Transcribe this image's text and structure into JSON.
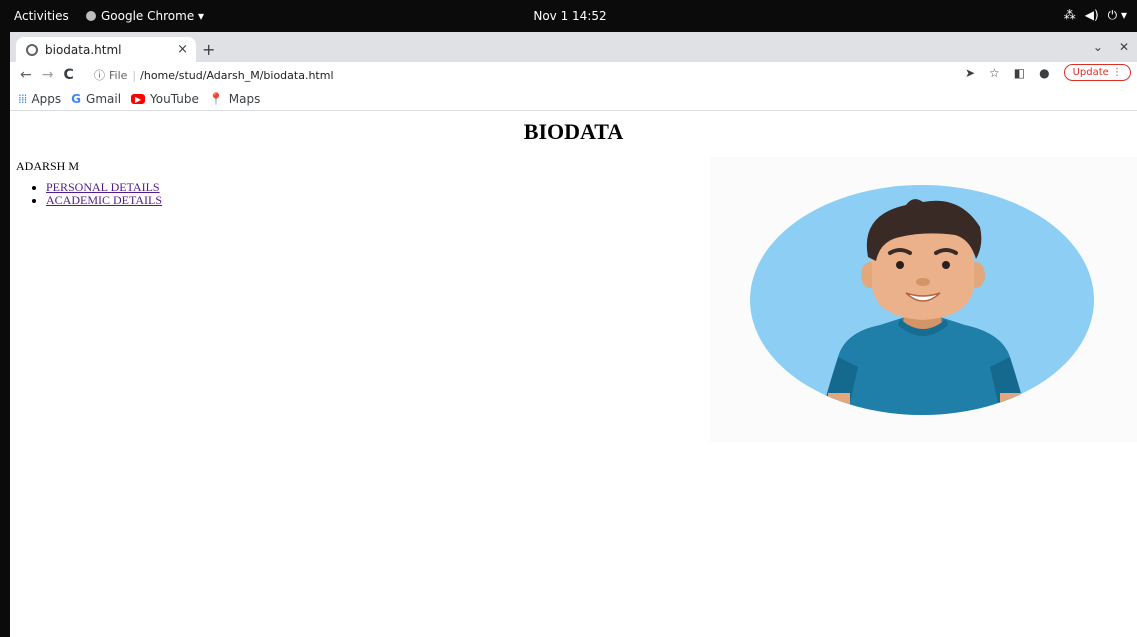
{
  "system_bar": {
    "activities": "Activities",
    "app_name": "Google Chrome ▾",
    "clock": "Nov 1  14:52"
  },
  "browser": {
    "tab_title": "biodata.html",
    "tab_close": "×",
    "new_tab": "+",
    "nav": {
      "back": "←",
      "forward": "→",
      "reload": "C"
    },
    "address": {
      "scheme_label": "File",
      "separator": "|",
      "url": "/home/stud/Adarsh_M/biodata.html"
    },
    "update_label": "Update",
    "bookmarks": [
      {
        "label": "Apps",
        "icon": "apps-icon"
      },
      {
        "label": "Gmail",
        "icon": "google-icon"
      },
      {
        "label": "YouTube",
        "icon": "youtube-icon"
      },
      {
        "label": "Maps",
        "icon": "maps-icon"
      }
    ]
  },
  "page": {
    "title": "BIODATA",
    "name": "ADARSH M",
    "links": [
      {
        "label": "PERSONAL DETAILS"
      },
      {
        "label": "ACADEMIC DETAILS"
      }
    ]
  }
}
